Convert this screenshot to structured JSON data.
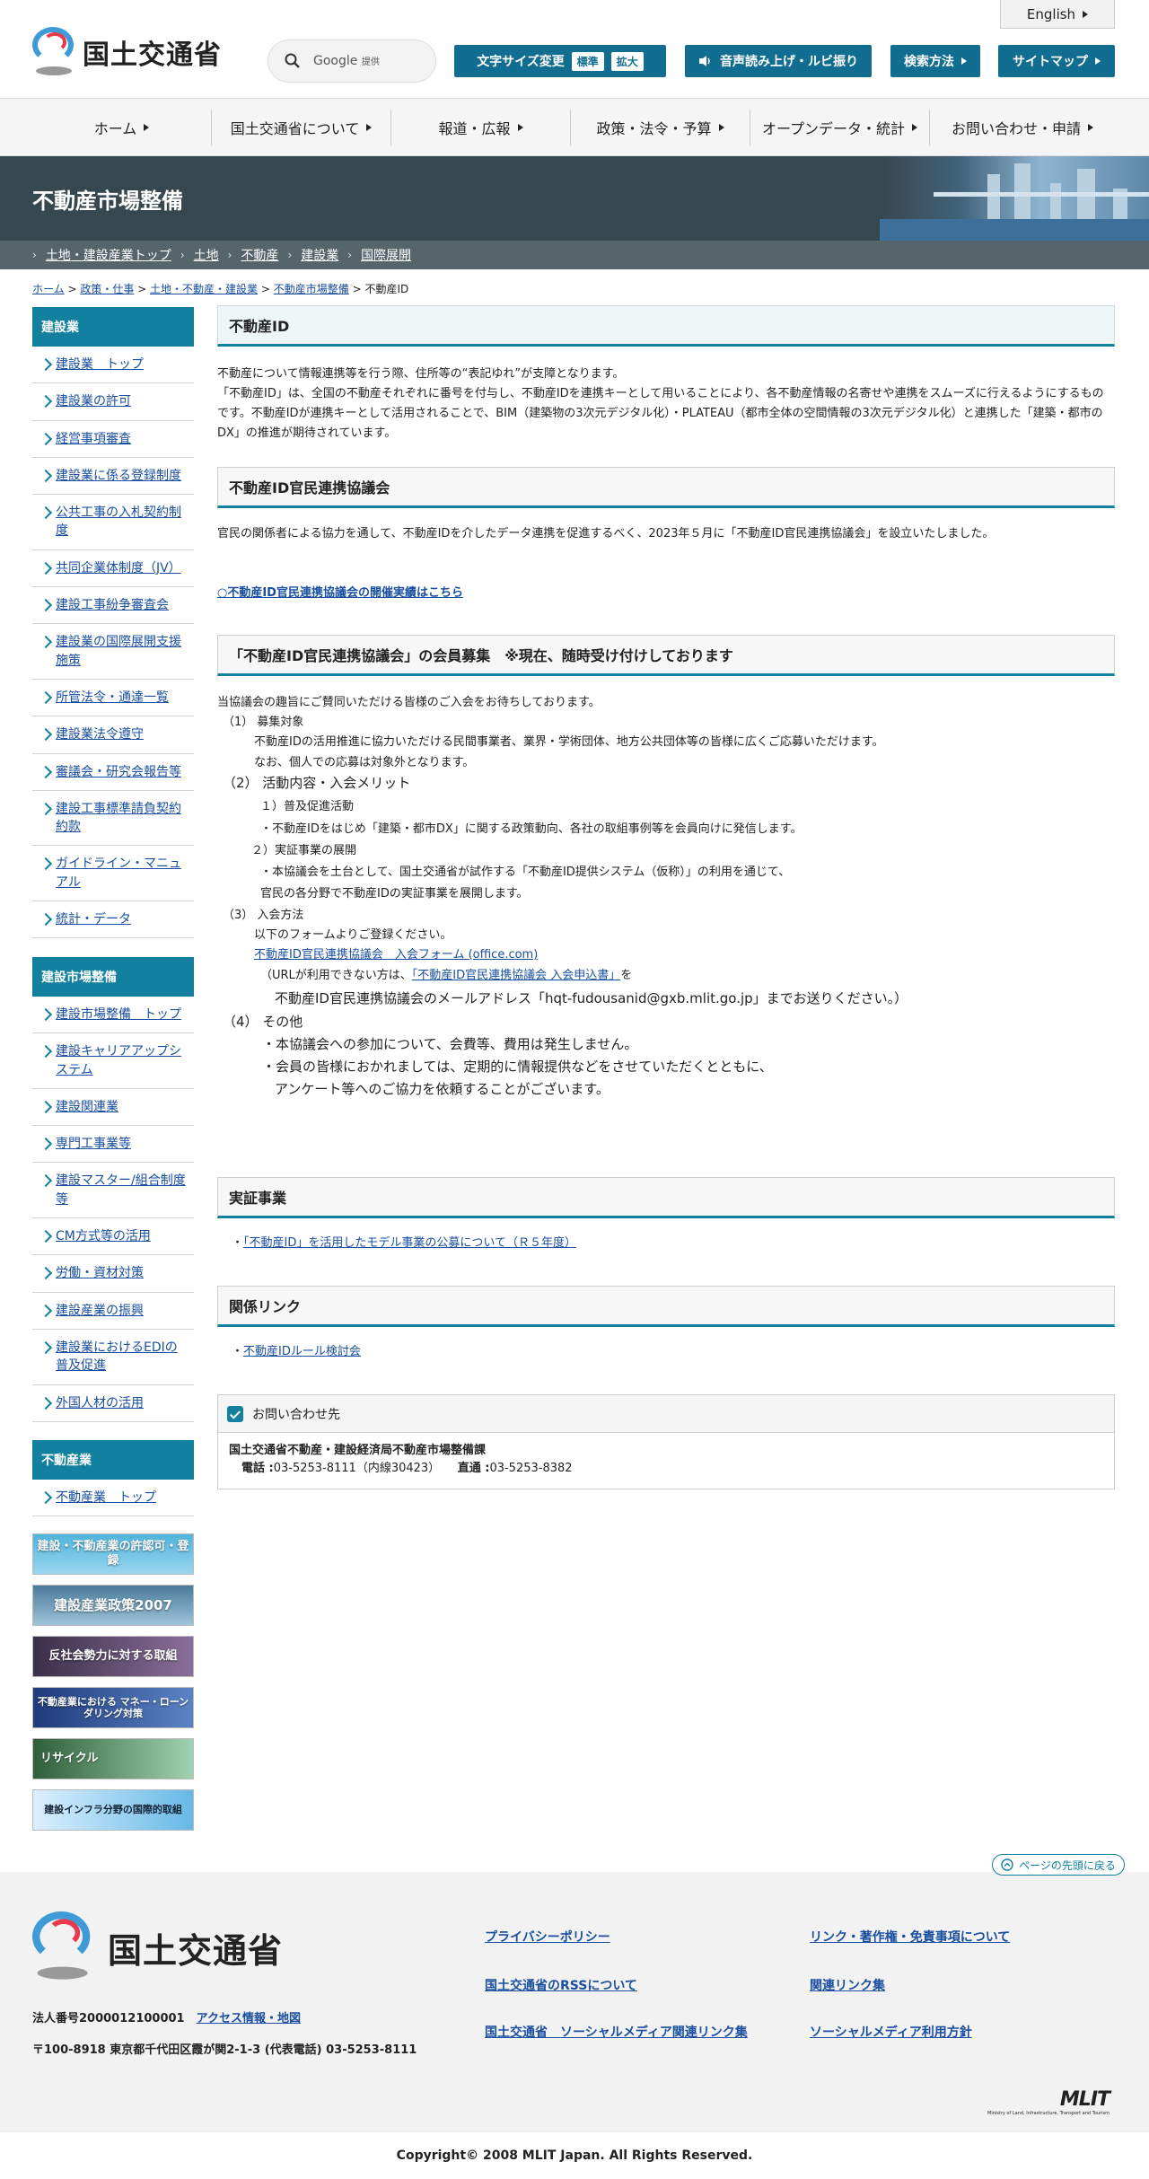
{
  "header": {
    "english": "English",
    "logo_text": "国土交通省",
    "search_brand": "Google",
    "search_sub": "提供",
    "textsize_label": "文字サイズ変更",
    "size_standard": "標準",
    "size_large": "拡大",
    "voice_label": "音声読み上げ・ルビ振り",
    "search_method": "検索方法",
    "sitemap": "サイトマップ"
  },
  "nav": [
    "ホーム",
    "国土交通省について",
    "報道・広報",
    "政策・法令・予算",
    "オープンデータ・統計",
    "お問い合わせ・申請"
  ],
  "banner": {
    "title": "不動産市場整備"
  },
  "subnav": [
    "土地・建設産業トップ",
    "土地",
    "不動産",
    "建設業",
    "国際展開"
  ],
  "breadcrumb": {
    "b1": "ホーム",
    "b2": "政策・仕事",
    "b3": "土地・不動産・建設業",
    "b4": "不動産市場整備",
    "current": "不動産ID",
    "sep": " > "
  },
  "sidebar": {
    "construction": {
      "title": "建設業",
      "items": [
        "建設業　トップ",
        "建設業の許可",
        "経営事項審査",
        "建設業に係る登録制度",
        "公共工事の入札契約制度",
        "共同企業体制度（JV）",
        "建設工事紛争審査会",
        "建設業の国際展開支援施策",
        "所管法令・通達一覧",
        "建設業法令遵守",
        "審議会・研究会報告等",
        "建設工事標準請負契約約款",
        "ガイドライン・マニュアル",
        "統計・データ"
      ]
    },
    "market": {
      "title": "建設市場整備",
      "items": [
        "建設市場整備　トップ",
        "建設キャリアアップシステム",
        "建設関連業",
        "専門工事業等",
        "建設マスター/組合制度等",
        "CM方式等の活用",
        "労働・資材対策",
        "建設産業の振興",
        "建設業におけるEDIの普及促進",
        "外国人材の活用"
      ]
    },
    "realestate": {
      "title": "不動産業",
      "items": [
        "不動産業　トップ"
      ]
    },
    "banners": [
      "建設・不動産業の許認可・登録",
      "建設産業政策2007",
      "反社会勢力に対する取組",
      "不動産業における マネー・ローンダリング対策",
      "リサイクル",
      "建設インフラ分野の国際的取組"
    ]
  },
  "main": {
    "h_realestate_id": "不動産ID",
    "intro1": "不動産について情報連携等を行う際、住所等の“表記ゆれ”が支障となります。",
    "intro2": "「不動産ID」は、全国の不動産それぞれに番号を付与し、不動産IDを連携キーとして用いることにより、各不動産情報の名寄せや連携をスムーズに行えるようにするものです。不動産IDが連携キーとして活用されることで、BIM（建築物の3次元デジタル化）・PLATEAU（都市全体の空間情報の3次元デジタル化）と連携した「建築・都市のDX」の推進が期待されています。",
    "h_council": "不動産ID官民連携協議会",
    "council_text": "官民の関係者による協力を通して、不動産IDを介したデータ連携を促進するべく、2023年５月に「不動産ID官民連携協議会」を設立いたしました。",
    "council_link": "○不動産ID官民連携協議会の開催実績はこちら",
    "h_members": "「不動産ID官民連携協議会」の会員募集　※現在、随時受け付けしております",
    "m_intro": "当協議会の趣旨にご賛同いただける皆様のご入会をお待ちしております。",
    "m1": "（1）  募集対象",
    "m1a": "不動産IDの活用推進に協力いただける民間事業者、業界・学術団体、地方公共団体等の皆様に広くご応募いただけます。",
    "m1b": "なお、個人での応募は対象外となります。",
    "m2": "（2） 活動内容・入会メリット",
    "m2a": "１）普及促進活動",
    "m2b": "・不動産IDをはじめ「建築・都市DX」に関する政策動向、各社の取組事例等を会員向けに発信します。",
    "m2c": "２）実証事業の展開",
    "m2d": "・本協議会を土台として、国土交通省が試作する「不動産ID提供システム（仮称）」の利用を通じて、",
    "m2e": "官民の各分野で不動産IDの実証事業を展開します。",
    "m3": "（3） 入会方法",
    "m3a": "以下のフォームよりご登録ください。",
    "m3_link": "不動産ID官民連携協議会　入会フォーム (office.com)",
    "m3b_pre": "（URLが利用できない方は、",
    "m3b_link": "「不動産ID官民連携協議会 入会申込書」",
    "m3b_post": "を",
    "m3c": "不動産ID官民連携協議会のメールアドレス「hqt-fudousanid@gxb.mlit.go.jp」までお送りください。）",
    "m4": "（4） その他",
    "m4a": "・本協議会への参加について、会費等、費用は発生しません。",
    "m4b": "・会員の皆様におかれましては、定期的に情報提供などをさせていただくとともに、",
    "m4c": "アンケート等へのご協力を依頼することがございます。",
    "h_demo": "実証事業",
    "demo_bullet": "・",
    "demo_link": "「不動産ID」を活用したモデル事業の公募について（Ｒ５年度）",
    "h_links": "関係リンク",
    "links_bullet": "・",
    "links_link": "不動産IDルール検討会"
  },
  "contact": {
    "title": "お問い合わせ先",
    "dept": "国土交通省不動産・建設経済局不動産市場整備課",
    "tel_label": "電話 :",
    "tel": "03-5253-8111（内線30423）",
    "direct_label": "直通 :",
    "direct": "03-5253-8382"
  },
  "footer": {
    "pagetop": "ページの先頭に戻る",
    "logo_text": "国土交通省",
    "corp_no": "法人番号2000012100001",
    "access": "アクセス情報・地図",
    "address": "〒100-8918 東京都千代田区霞が関2-1-3 (代表電話) 03-5253-8111",
    "links": [
      "プライバシーポリシー",
      "リンク・著作権・免責事項について",
      "国土交通省のRSSについて",
      "関連リンク集",
      "国土交通省　ソーシャルメディア関連リンク集",
      "ソーシャルメディア利用方針"
    ],
    "mlit": "MLIT",
    "mlit_sub": "Ministry of Land, Infrastructure, Transport and Tourism",
    "copyright": "Copyright© 2008 MLIT Japan. All Rights Reserved."
  },
  "colors": {
    "accent": "#12809f",
    "header_button": "#126e91",
    "banner": "#37474f",
    "link": "#1a4fa0"
  }
}
